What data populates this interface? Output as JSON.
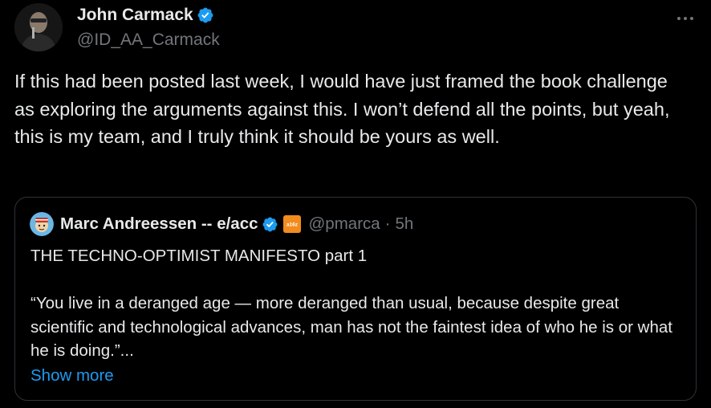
{
  "author": {
    "display_name": "John Carmack",
    "handle": "@ID_AA_Carmack",
    "verified": true
  },
  "more_icon": "more-horizontal-icon",
  "tweet": {
    "text": "If this had been posted last week, I would have just framed the book challenge as exploring the arguments against this. I won’t defend all the points, but yeah, this is my team, and I truly think it should be yours as well."
  },
  "quote": {
    "display_name": "Marc Andreessen -- e/acc",
    "affiliation_badge": "a16z",
    "handle": "@pmarca",
    "separator": "·",
    "time": "5h",
    "title": "THE TECHNO-OPTIMIST MANIFESTO part 1",
    "body": "“You live in a deranged age — more deranged than usual, because despite great scientific and technological advances, man has not the faintest idea of who he is or what he is doing.”...",
    "show_more_label": "Show more"
  },
  "colors": {
    "background": "#000000",
    "text": "#e7e9ea",
    "muted": "#71767b",
    "accent": "#1d9bf0",
    "border": "#2f3336"
  }
}
